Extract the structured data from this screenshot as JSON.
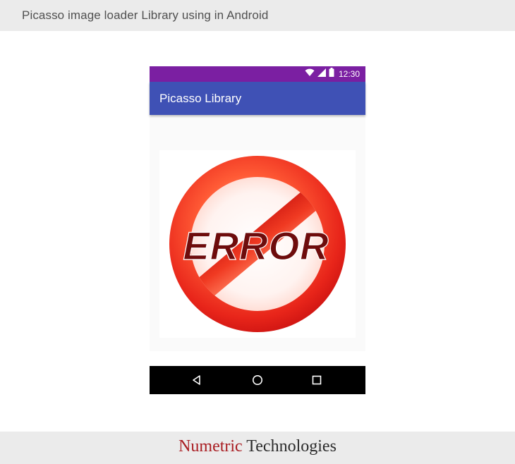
{
  "banner": {
    "title": "Picasso image loader Library using in Android"
  },
  "phone": {
    "status_bar": {
      "time": "12:30",
      "icons": [
        "wifi-icon",
        "signal-icon",
        "battery-icon"
      ],
      "color": "#7b1fa2"
    },
    "app_bar": {
      "title": "Picasso Library",
      "color": "#3f51b5"
    },
    "image": {
      "text": "ERROR",
      "description_icon": "error-prohibition-sign"
    },
    "nav_bar": {
      "buttons": [
        "back-icon",
        "home-icon",
        "recents-icon"
      ]
    }
  },
  "footer": {
    "brand_first": "Numetric",
    "brand_second": "Technologies",
    "brand_first_color": "#a91d22",
    "brand_second_color": "#2b2b2b"
  }
}
